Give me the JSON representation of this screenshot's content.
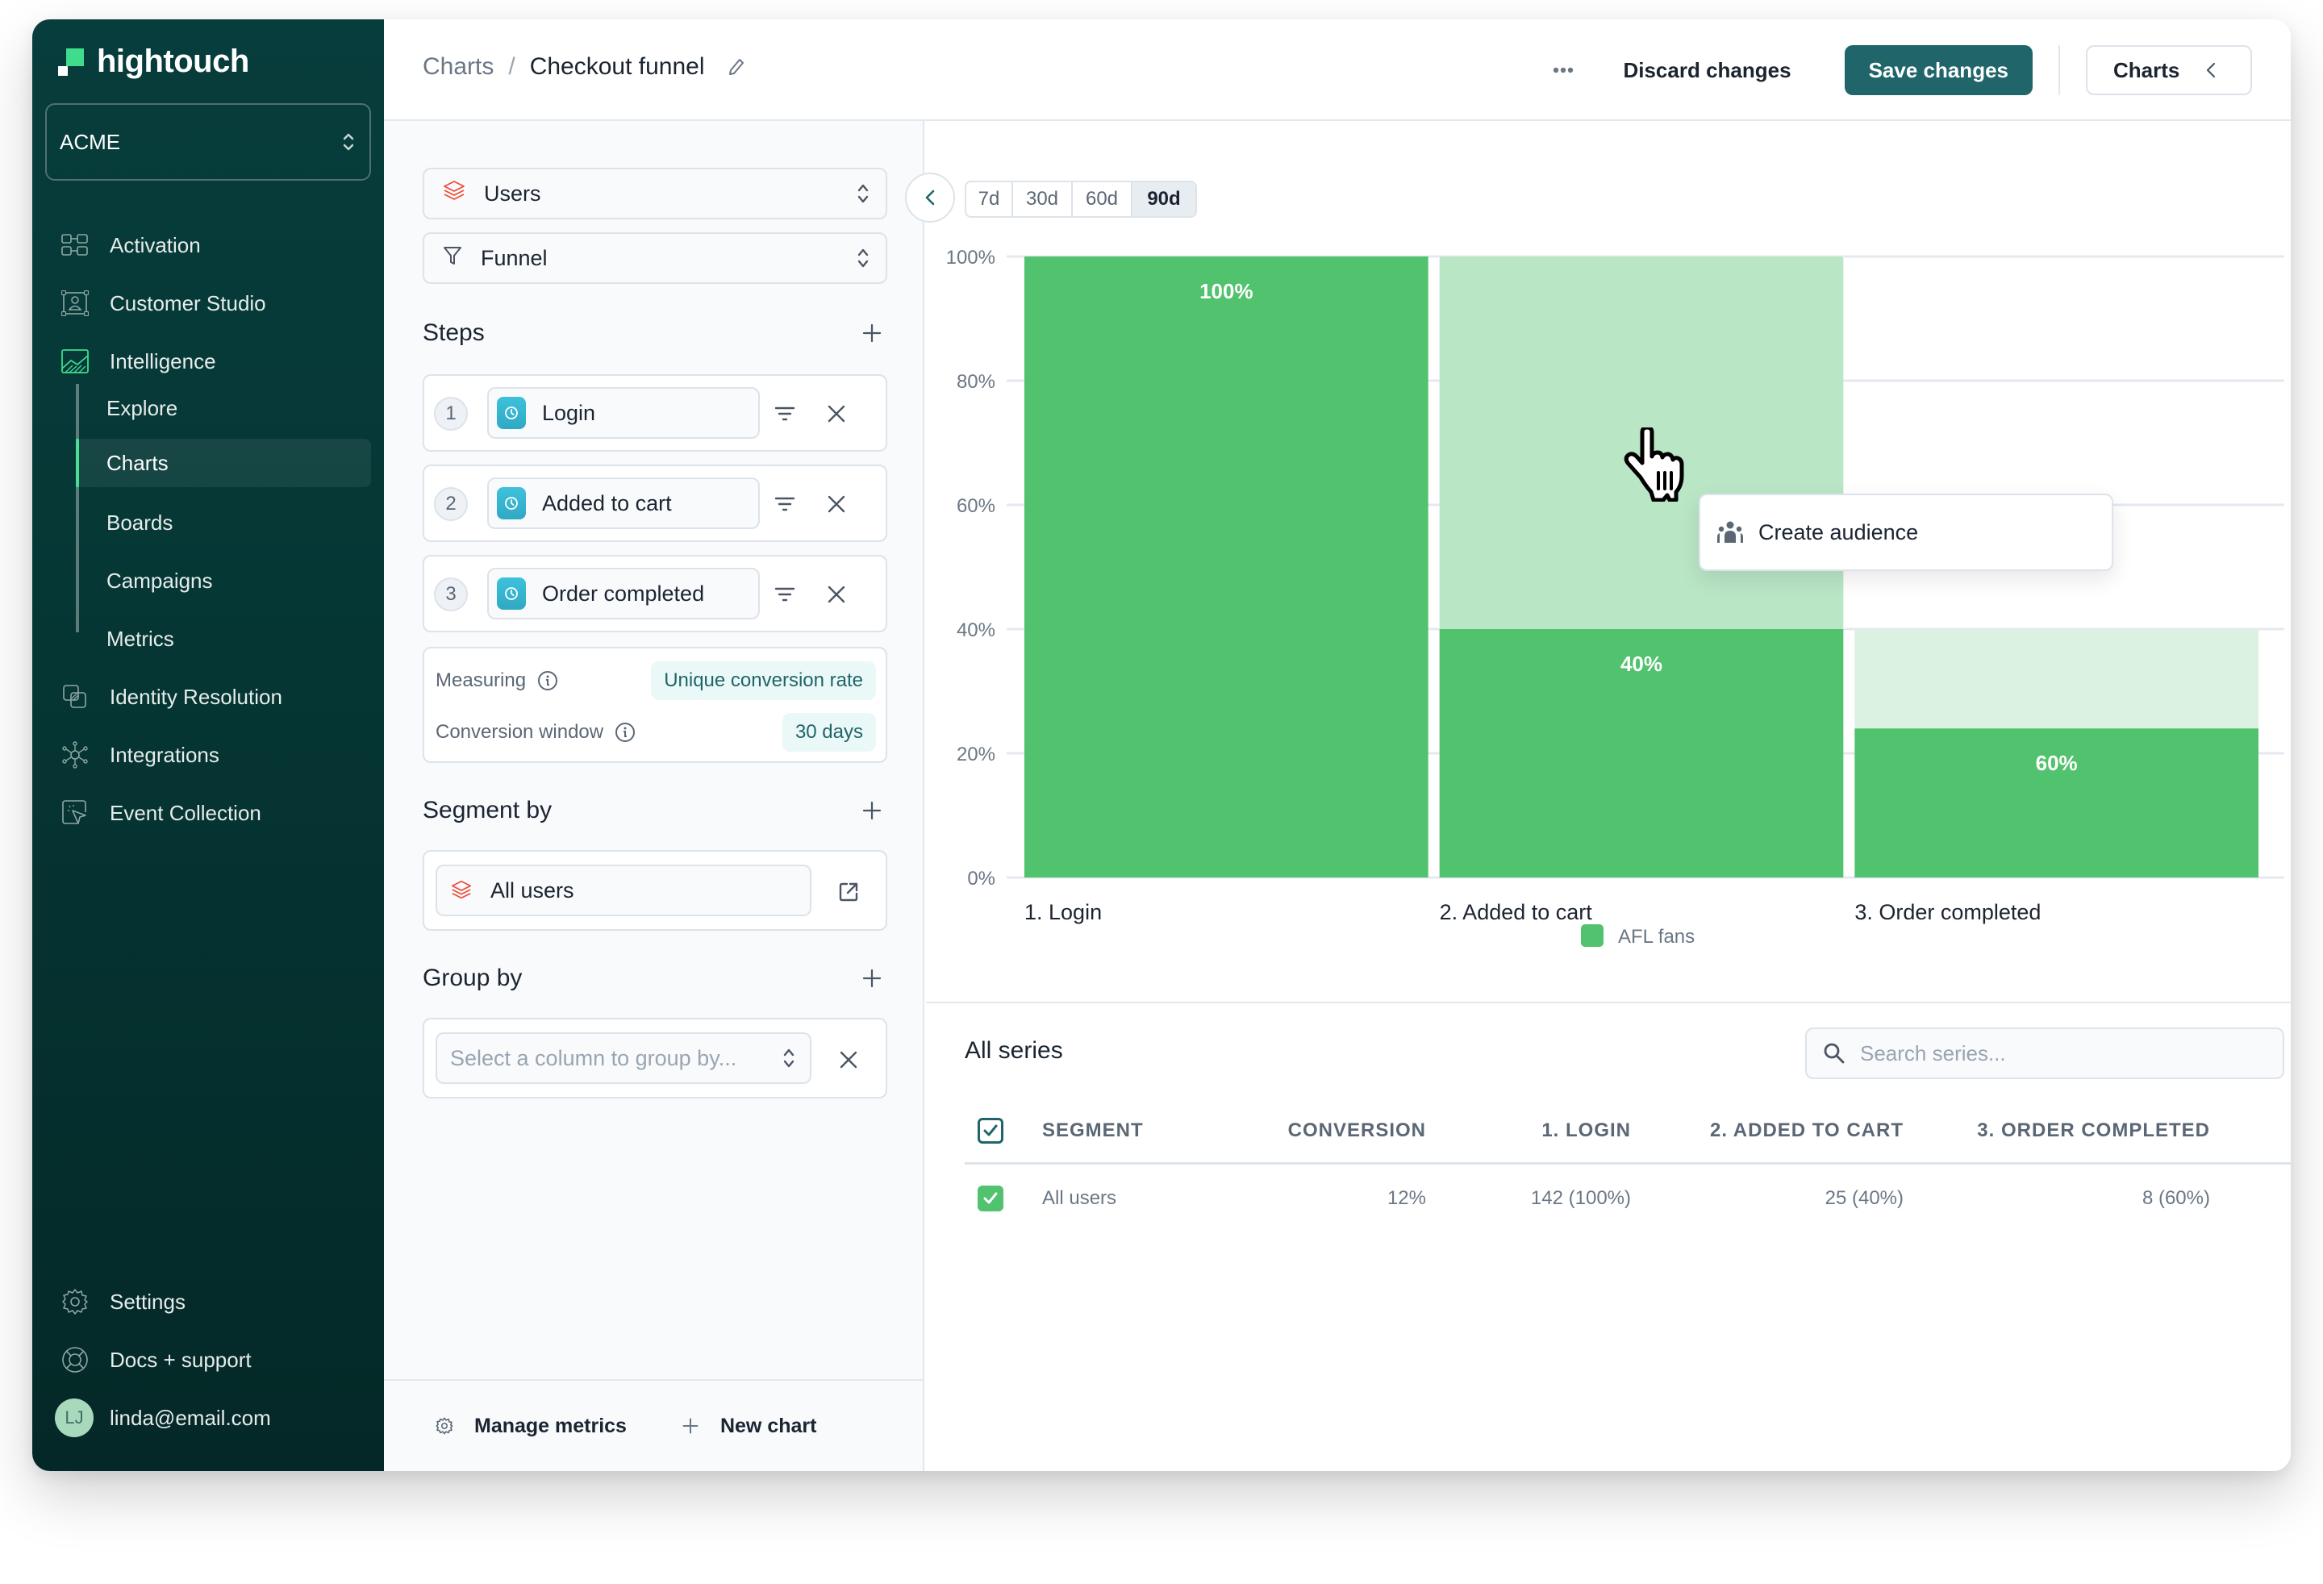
{
  "app": {
    "brand": "hightouch",
    "workspace": "ACME"
  },
  "sidebar": {
    "items": [
      {
        "label": "Activation",
        "icon": "activation-icon"
      },
      {
        "label": "Customer Studio",
        "icon": "customer-studio-icon"
      },
      {
        "label": "Intelligence",
        "icon": "intelligence-icon"
      }
    ],
    "sub_items": [
      {
        "label": "Explore"
      },
      {
        "label": "Charts",
        "active": true
      },
      {
        "label": "Boards"
      },
      {
        "label": "Campaigns"
      },
      {
        "label": "Metrics"
      }
    ],
    "items_after": [
      {
        "label": "Identity Resolution",
        "icon": "identity-resolution-icon"
      },
      {
        "label": "Integrations",
        "icon": "integrations-icon"
      },
      {
        "label": "Event Collection",
        "icon": "event-collection-icon"
      }
    ],
    "bottom": {
      "settings": "Settings",
      "docs": "Docs + support",
      "user_initials": "LJ",
      "user_email": "linda@email.com"
    }
  },
  "header": {
    "breadcrumb_parent": "Charts",
    "breadcrumb_sep": "/",
    "title": "Checkout funnel",
    "discard_label": "Discard changes",
    "save_label": "Save changes",
    "charts_toggle_label": "Charts"
  },
  "config": {
    "model_select": "Users",
    "chart_type_select": "Funnel",
    "steps_title": "Steps",
    "steps": [
      {
        "number": "1",
        "event": "Login"
      },
      {
        "number": "2",
        "event": "Added to cart"
      },
      {
        "number": "3",
        "event": "Order completed"
      }
    ],
    "measuring_label": "Measuring",
    "measuring_value": "Unique conversion rate",
    "conversion_window_label": "Conversion window",
    "conversion_window_value": "30 days",
    "segment_title": "Segment by",
    "segment_value": "All users",
    "group_title": "Group by",
    "group_placeholder": "Select a column to group by...",
    "footer_manage": "Manage metrics",
    "footer_new": "New chart"
  },
  "chart_controls": {
    "ranges": [
      "7d",
      "30d",
      "60d",
      "90d"
    ],
    "active_range": "90d"
  },
  "colors": {
    "bar": "#51c26d",
    "bar_dropoff_hover": "#b9e6c5",
    "bar_dropoff": "#dbf1e1",
    "brand_teal": "#1f6569",
    "brand_green": "#3fdc8c"
  },
  "chart_data": {
    "type": "bar",
    "title": "",
    "xlabel": "",
    "ylabel": "",
    "categories": [
      "1. Login",
      "2. Added to cart",
      "3. Order completed"
    ],
    "ylim": [
      0,
      100
    ],
    "yticks": [
      0,
      20,
      40,
      60,
      80,
      100
    ],
    "ytick_labels": [
      "0%",
      "20%",
      "40%",
      "60%",
      "80%",
      "100%"
    ],
    "grid": true,
    "series": [
      {
        "name": "AFL fans",
        "values": [
          100,
          40,
          24
        ],
        "data_labels": [
          "100%",
          "40%",
          "60%"
        ],
        "previous_step_values": [
          100,
          100,
          40
        ]
      }
    ],
    "hovered_category": "2. Added to cart",
    "legend": {
      "position": "bottom",
      "entries": [
        "AFL fans"
      ]
    }
  },
  "context_menu": {
    "items": [
      {
        "label": "Create audience",
        "icon": "audience-icon"
      }
    ]
  },
  "table": {
    "title": "All series",
    "search_placeholder": "Search series...",
    "columns": [
      "SEGMENT",
      "CONVERSION",
      "1. LOGIN",
      "2. ADDED TO CART",
      "3. ORDER COMPLETED"
    ],
    "rows": [
      {
        "checked": true,
        "segment": "All users",
        "conversion": "12%",
        "login": "142 (100%)",
        "added_to_cart": "25 (40%)",
        "order_completed": "8 (60%)"
      }
    ]
  }
}
